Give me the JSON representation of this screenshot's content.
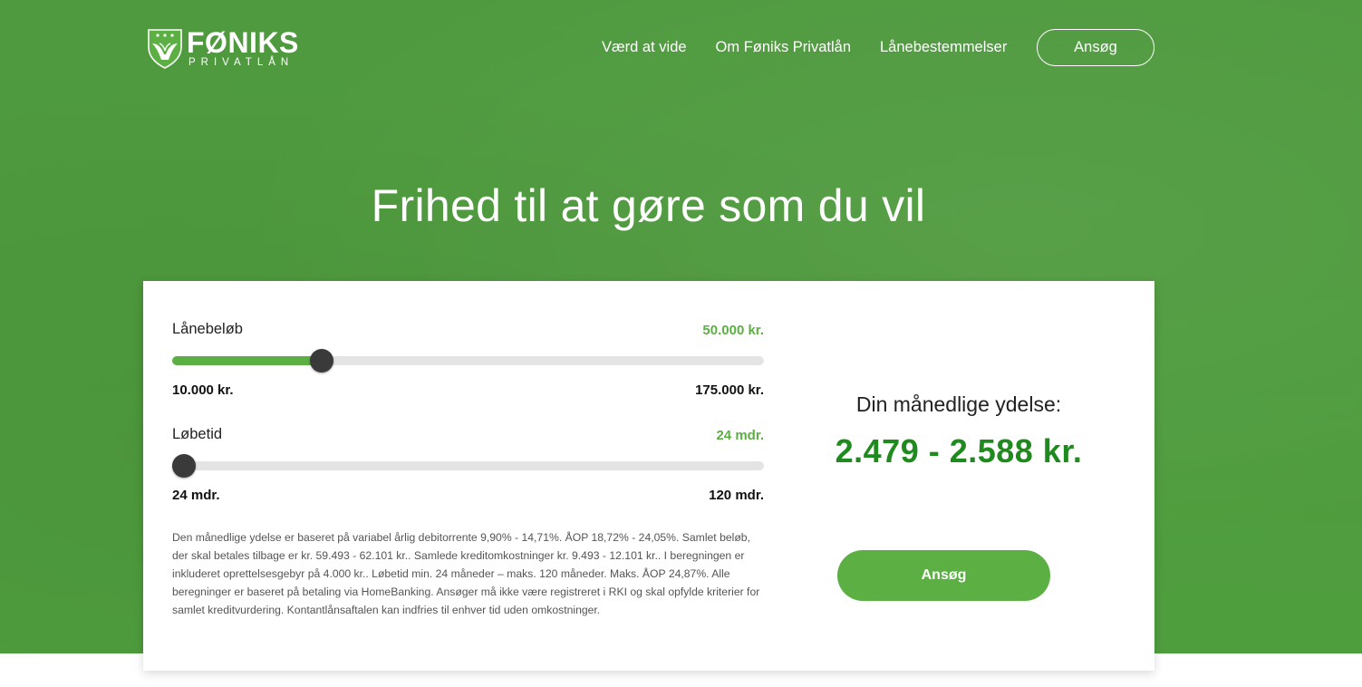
{
  "brand": {
    "name": "FØNIKS",
    "sub": "PRIVATLÅN",
    "color": "#4e9a3d",
    "accent": "#5cb043",
    "result_color": "#1f8a1d"
  },
  "nav": {
    "items": [
      {
        "label": "Værd at vide"
      },
      {
        "label": "Om Føniks Privatlån"
      },
      {
        "label": "Lånebestemmelser"
      }
    ],
    "apply_label": "Ansøg"
  },
  "hero": {
    "headline": "Frihed til at gøre som du vil"
  },
  "calculator": {
    "loan": {
      "label": "Lånebeløb",
      "value_label": "50.000 kr.",
      "min_label": "10.000 kr.",
      "max_label": "175.000 kr.",
      "value": 50000,
      "min": 10000,
      "max": 175000
    },
    "term": {
      "label": "Løbetid",
      "value_label": "24 mdr.",
      "min_label": "24 mdr.",
      "max_label": "120 mdr.",
      "value": 24,
      "min": 24,
      "max": 120
    },
    "disclaimer": "Den månedlige ydelse er baseret på variabel årlig debitorrente 9,90% - 14,71%. ÅOP 18,72% - 24,05%. Samlet beløb, der skal betales tilbage er kr. 59.493 - 62.101 kr.. Samlede kreditomkostninger kr. 9.493 - 12.101 kr.. I beregningen er inkluderet oprettelsesgebyr på 4.000 kr.. Løbetid min. 24 måneder – maks. 120 måneder. Maks. ÅOP 24,87%. Alle beregninger er baseret på betaling via HomeBanking. Ansøger må ikke være registreret i RKI og skal opfylde kriterier for samlet kreditvurdering. Kontantlånsaftalen kan indfries til enhver tid uden omkostninger.",
    "result_label": "Din månedlige ydelse:",
    "result_value": "2.479 - 2.588  kr.",
    "apply_label": "Ansøg"
  },
  "icons": {
    "logo": "phoenix-shield-icon"
  }
}
